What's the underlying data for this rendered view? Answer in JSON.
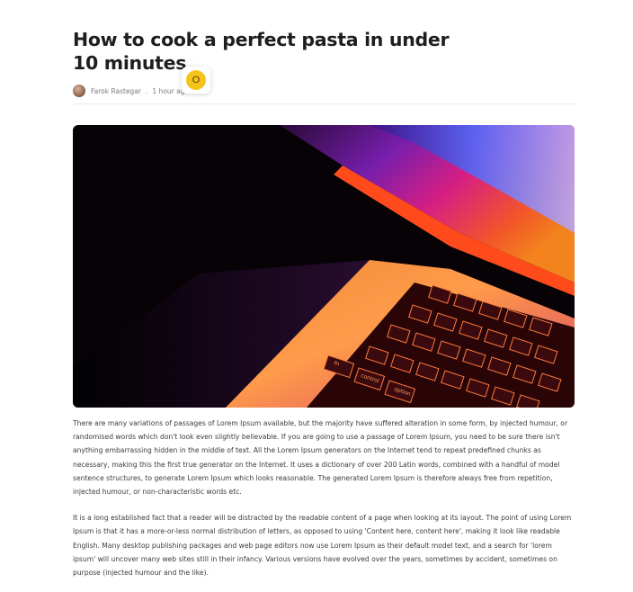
{
  "article": {
    "title": "How to cook a perfect pasta in under 10 minutes",
    "author": "Farok Rastegar",
    "separator": ".",
    "time_ago": "1 hour ago",
    "hero_image": "laptop-keyboard-photo",
    "paragraphs": [
      "There are many variations of passages of Lorem Ipsum available, but the majority have suffered alteration in some form, by injected humour, or randomised words which don't look even slightly believable. If you are going to use a passage of Lorem Ipsum, you need to be sure there isn't anything embarrassing hidden in the middle of text. All the Lorem Ipsum generators on the Internet tend to repeat predefined chunks as necessary, making this the first true generator on the Internet. It uses a dictionary of over 200 Latin words, combined with a handful of model sentence structures, to generate Lorem Ipsum which looks reasonable. The generated Lorem Ipsum is therefore always free from repetition, injected humour, or non-characteristic words etc.",
      "It is a long established fact that a reader will be distracted by the readable content of a page when looking at its layout. The point of using Lorem Ipsum is that it has a more-or-less normal distribution of letters, as opposed to using 'Content here, content here', making it look like readable English. Many desktop publishing packages and web page editors now use Lorem Ipsum as their default model text, and a search for 'lorem ipsum' will uncover many web sites still in their infancy. Various versions have evolved over the years, sometimes by accident, sometimes on purpose (injected humour and the like)."
    ]
  },
  "badge": {
    "letter": "O",
    "color": "#f6c21c"
  },
  "keyboard_keys": [
    "fn",
    "control",
    "option"
  ]
}
